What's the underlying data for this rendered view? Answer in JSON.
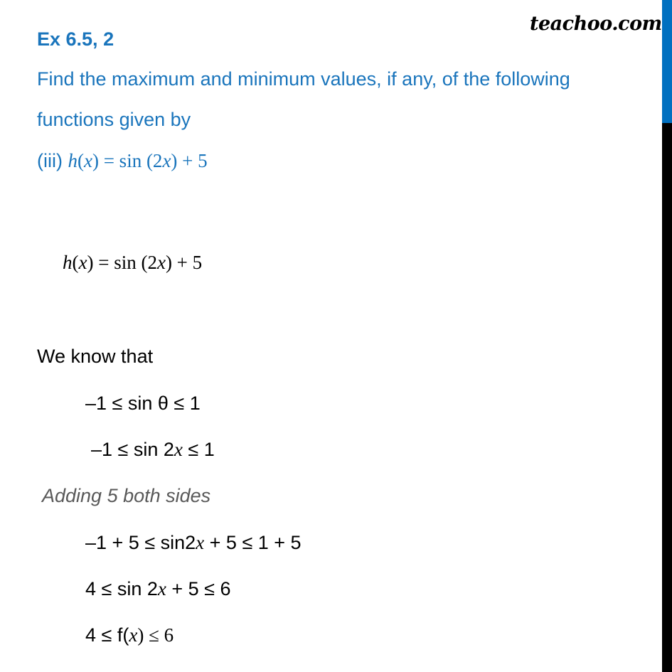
{
  "brand": {
    "text": "teachoo.com"
  },
  "colors": {
    "accent_blue": "#1a75bc",
    "sidebar_blue": "#0070c0",
    "sidebar_black": "#000000",
    "note_gray": "#595959"
  },
  "question": {
    "title": "Ex 6.5, 2",
    "line1": "Find the maximum and minimum values, if any, of the following",
    "line2": "functions given by",
    "part_label": "(iii) ",
    "part_expr": {
      "h": "h",
      "lp": "(",
      "x": "x",
      "rest1": ") =  sin (2",
      "x2": "x",
      "rest2": ") +  5"
    }
  },
  "solution": {
    "eq": {
      "h": "h",
      "lp": "(",
      "x": "x",
      "rest1": ") =  sin (2",
      "x2": "x",
      "rest2": ") +  5"
    },
    "we_know": "We know that",
    "ineq1": "–1 ≤  sin θ  ≤  1",
    "ineq2": {
      "a": "–1 ≤  sin 2",
      "x": "x",
      "b": "  ≤  1"
    },
    "note": "Adding  5  both sides",
    "ineq3": {
      "a": "–1 + 5 ≤  sin2",
      "x": "x",
      "b": " + 5 ≤  1 + 5"
    },
    "ineq4": {
      "a": "4 ≤  sin 2",
      "x": "x",
      "b": " + 5 ≤  6"
    },
    "ineq5": {
      "a": "4 ≤ f(",
      "x": "x",
      "b": ") ≤ 6"
    }
  }
}
